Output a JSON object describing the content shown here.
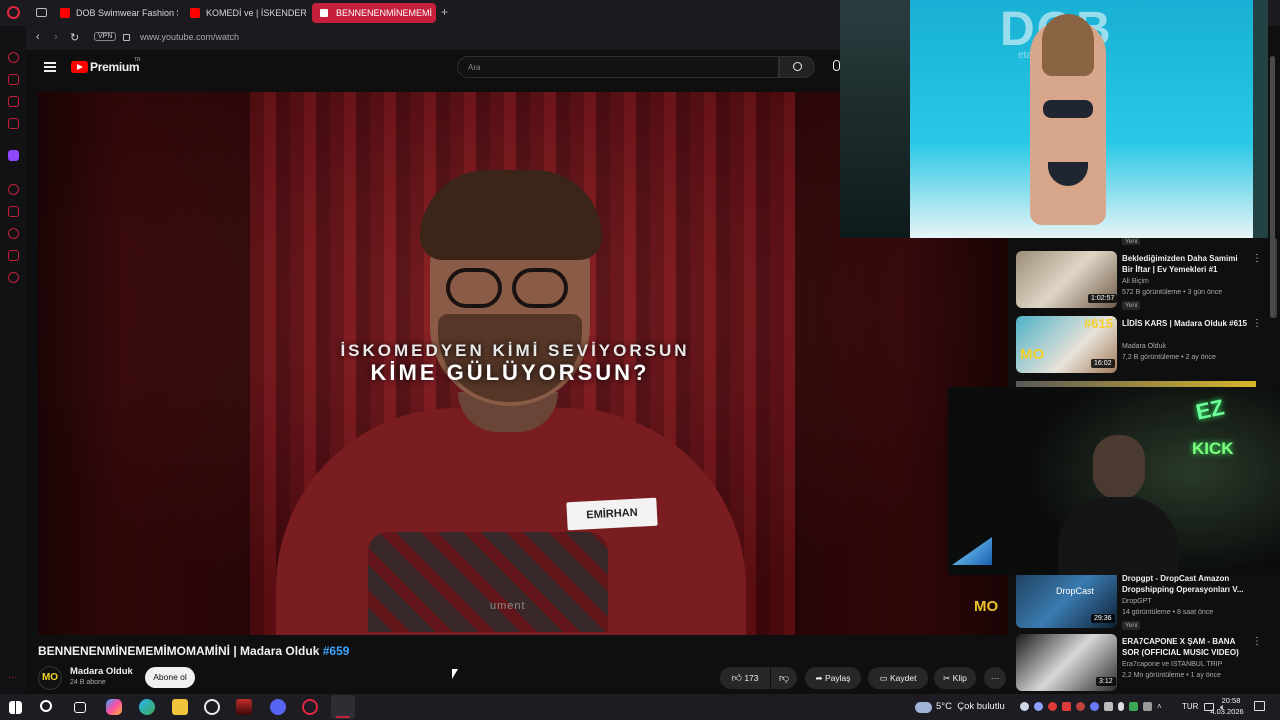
{
  "tabs": [
    {
      "label": "DOB Swimwear Fashion S"
    },
    {
      "label": "KOMEDİ ve | İSKENDER -"
    },
    {
      "label": "BENNENENMİNEMEMİ"
    }
  ],
  "address": {
    "vpn": "VPN",
    "url": "www.youtube.com/watch"
  },
  "youtube": {
    "logo": "Premium",
    "logo_region": "TR",
    "search_placeholder": "Ara"
  },
  "player": {
    "overlay_line1": "İSKOMEDYEN KİMİ SEVİYORSUN",
    "overlay_line2": "KİME GÜLÜYORSUN?",
    "name_tag": "EMİRHAN",
    "shirt_text": "ument",
    "watermark": "MO"
  },
  "video": {
    "title": "BENNENENMİNEMEMİMOMAMİNİ | Madara Olduk",
    "hashtag": "#659",
    "channel": "Madara Olduk",
    "subscribers": "24 B abone",
    "subscribe_label": "Abone ol",
    "likes": "173",
    "share_label": "Paylaş",
    "save_label": "Kaydet",
    "clip_label": "Klip"
  },
  "overlays": {
    "runway_logo": "DOB",
    "runway_sub": "etam swimwear",
    "kick_text1": "EZ",
    "kick_text2": "KICK"
  },
  "recommendations": [
    {
      "title": "Beklediğimizden Daha Samimi Bir İftar | Ev Yemekleri #1",
      "channel": "Ali Biçim",
      "meta": "572 B görüntüleme • 3 gün önce",
      "badge": "Yeni",
      "duration": "1:02:57"
    },
    {
      "title": "LİDİS KARS | Madara Olduk #615",
      "channel": "Madara Olduk",
      "meta": "7,2 B görüntüleme • 2 ay önce",
      "badge": "",
      "duration": "16:02",
      "thumb_text": "#615"
    },
    {
      "title": "Dropgpt - DropCast Amazon Dropshipping Operasyonları V...",
      "channel": "DropGPT",
      "meta": "14 görüntüleme • 8 saat önce",
      "badge": "Yeni",
      "duration": "29:36",
      "thumb_text": "DropCast"
    },
    {
      "title": "ERA7CAPONE X ŞAM - BANA SOR (OFFICIAL MUSIC VIDEO)",
      "channel": "Era7capone ve ISTANBUL TRIP",
      "meta": "2,2 Mn görüntüleme • 1 ay önce",
      "badge": "",
      "duration": "3:12"
    }
  ],
  "partial_rec_badge": "Yeni",
  "taskbar": {
    "weather": "5°C  Çok bulutlu",
    "lang": "TUR",
    "time": "20:58",
    "date": "4.03.2026"
  },
  "colors": {
    "youtube_red": "#ff0000",
    "opera_red": "#c4203b",
    "bg": "#0f0f0f"
  }
}
